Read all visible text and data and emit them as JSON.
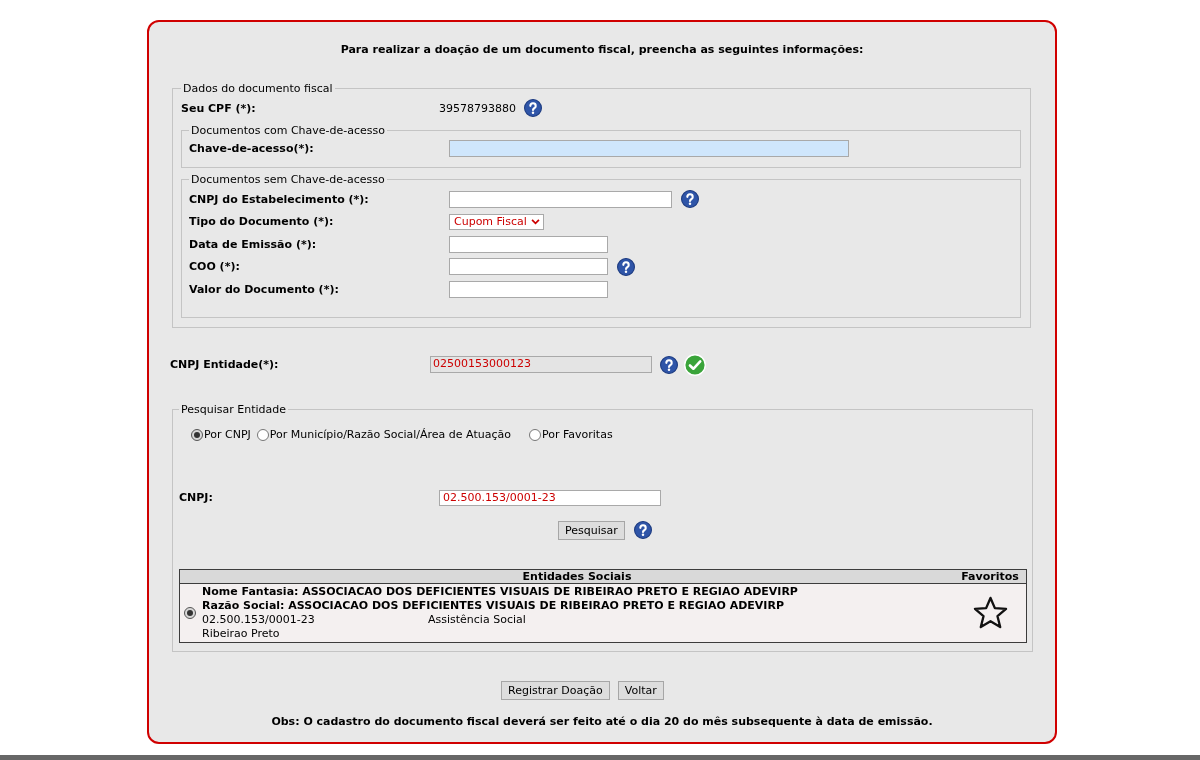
{
  "instructions": "Para realizar a doação de um documento fiscal, preencha as seguintes informações:",
  "document_section": {
    "legend": "Dados do documento fiscal",
    "cpf": {
      "label": "Seu CPF (*):",
      "value": "39578793880",
      "help": true
    },
    "with_access_key": {
      "legend": "Documentos com Chave-de-acesso",
      "fields": [
        {
          "kind": "text",
          "label": "Chave-de-acesso(*):",
          "focused": true,
          "help": false
        }
      ]
    },
    "without_access_key": {
      "legend": "Documentos sem Chave-de-acesso",
      "fields": [
        {
          "kind": "text",
          "label": "CNPJ do Estabelecimento (*):",
          "focused": false,
          "help": true
        },
        {
          "kind": "select",
          "label": "Tipo do Documento (*):",
          "value": "Cupom Fiscal",
          "focused": false,
          "help": false
        },
        {
          "kind": "text",
          "label": "Data de Emissão (*):",
          "focused": false,
          "help": false
        },
        {
          "kind": "text",
          "label": "COO (*):",
          "focused": false,
          "help": true
        },
        {
          "kind": "text",
          "label": "Valor do Documento (*):",
          "focused": false,
          "help": false
        }
      ]
    }
  },
  "entity": {
    "label": "CNPJ Entidade(*):",
    "value": "02500153000123",
    "readonly": true,
    "help": true,
    "valid": true
  },
  "search": {
    "legend": "Pesquisar Entidade",
    "options": [
      {
        "label": "Por CNPJ",
        "selected": true
      },
      {
        "label": "Por Município/Razão Social/Área de Atuação",
        "selected": false
      },
      {
        "label": "Por Favoritas",
        "selected": false
      }
    ],
    "cnpj": {
      "label": "CNPJ:",
      "value": "02.500.153/0001-23"
    },
    "button": "Pesquisar",
    "help": true
  },
  "results": {
    "columns": [
      "Entidades Sociais",
      "Favoritos"
    ],
    "rows": [
      {
        "selected": true,
        "trade_name": "Nome Fantasia: ASSOCIACAO DOS DEFICIENTES VISUAIS DE RIBEIRAO PRETO E REGIAO ADEVIRP",
        "legal_name": "Razão Social: ASSOCIACAO DOS DEFICIENTES VISUAIS DE RIBEIRAO PRETO E REGIAO ADEVIRP",
        "cnpj": "02.500.153/0001-23",
        "area": "Assistência Social",
        "city": "Ribeirao Preto",
        "favorite": false
      }
    ]
  },
  "buttons": [
    "Registrar Doação",
    "Voltar"
  ],
  "note": "Obs: O cadastro do documento fiscal deverá ser feito até o dia 20 do mês subsequente à data de emissão."
}
